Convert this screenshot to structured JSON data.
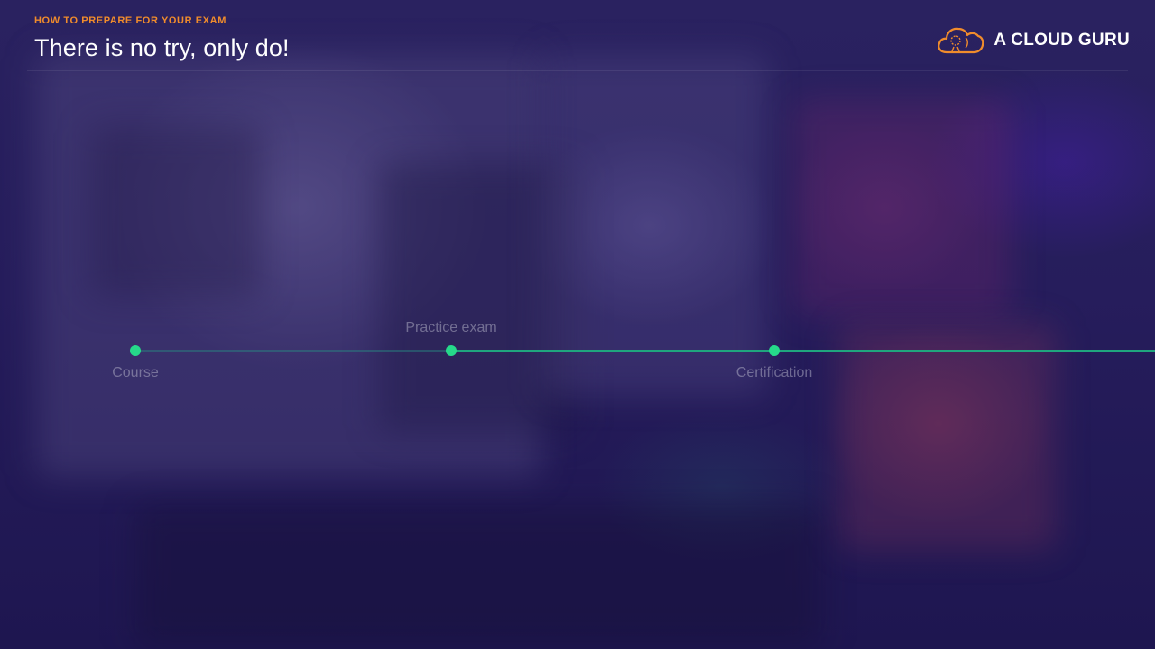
{
  "header": {
    "eyebrow": "HOW TO PREPARE FOR YOUR EXAM",
    "title": "There is no try, only do!"
  },
  "logo": {
    "icon": "cloud-icon",
    "text": "A CLOUD GURU",
    "accent_color": "#f08c2c"
  },
  "timeline": {
    "colors": {
      "dot": "#26d98a",
      "line": "#1fa67e"
    },
    "steps": [
      {
        "label": "Course"
      },
      {
        "label": "Practice exam"
      },
      {
        "label": "Certification"
      }
    ]
  }
}
